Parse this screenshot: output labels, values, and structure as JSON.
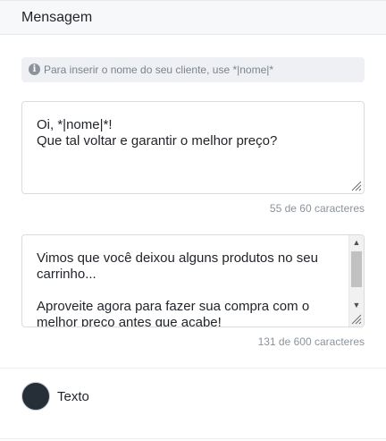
{
  "header": {
    "title": "Mensagem"
  },
  "info": {
    "icon": "info-icon",
    "text": "Para inserir o nome do seu cliente, use *|nome|*"
  },
  "headline_field": {
    "value": "Oi, *|nome|*!\nQue tal voltar e garantir o melhor preço?",
    "counter": "55 de 60 caracteres"
  },
  "body_field": {
    "value": "Vimos que você deixou alguns produtos no seu carrinho...\n\nAproveite agora para fazer sua compra com o melhor preco antes que acabe!",
    "counter": "131 de 600 caracteres"
  },
  "text_color": {
    "label": "Texto",
    "value": "#262e38"
  }
}
